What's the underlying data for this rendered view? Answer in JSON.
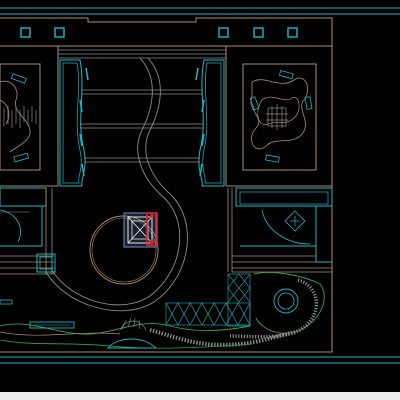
{
  "drawing": {
    "description_visible_text": "",
    "colors": {
      "background": "#000000",
      "cyan": "#19b9c8",
      "tan": "#b08b6a",
      "gray": "#8c8c8c",
      "green": "#2ea84a",
      "red": "#e2202a",
      "white": "#e6e6e6",
      "blue": "#5b7fae",
      "status_bar": "#eeeeee"
    },
    "icons": [
      "cad-drawing-canvas"
    ]
  }
}
